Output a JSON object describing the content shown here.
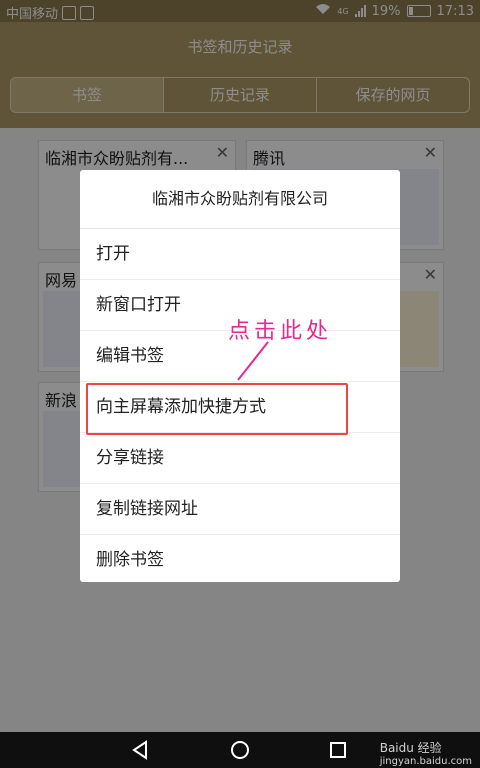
{
  "statusbar": {
    "carrier": "中国移动",
    "network": "4G",
    "battery": "19%",
    "time": "17:13"
  },
  "header": {
    "title": "书签和历史记录",
    "tabs": [
      {
        "label": "书签"
      },
      {
        "label": "历史记录"
      },
      {
        "label": "保存的网页"
      }
    ]
  },
  "bookmarks": [
    {
      "title": "临湘市众盼贴剂有..."
    },
    {
      "title": "腾讯"
    },
    {
      "title": "网易"
    },
    {
      "title": "新浪"
    }
  ],
  "dialog": {
    "title": "临湘市众盼贴剂有限公司",
    "items": [
      {
        "label": "打开"
      },
      {
        "label": "新窗口打开"
      },
      {
        "label": "编辑书签"
      },
      {
        "label": "向主屏幕添加快捷方式"
      },
      {
        "label": "分享链接"
      },
      {
        "label": "复制链接网址"
      },
      {
        "label": "删除书签"
      }
    ]
  },
  "annotation": {
    "text": "点击此处"
  },
  "watermark": {
    "brand": "Baidu 经验",
    "url": "jingyan.baidu.com"
  },
  "colors": {
    "header": "#b09a66",
    "annotation": "#e62a8f",
    "highlight": "#e44444"
  }
}
